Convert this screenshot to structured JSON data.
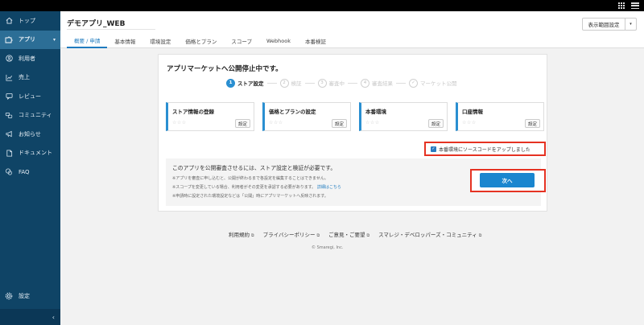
{
  "sidebar": {
    "items": [
      {
        "label": "トップ",
        "icon": "home-icon"
      },
      {
        "label": "アプリ",
        "icon": "puzzle-icon"
      },
      {
        "label": "利用者",
        "icon": "user-icon"
      },
      {
        "label": "売上",
        "icon": "trend-icon"
      },
      {
        "label": "レビュー",
        "icon": "review-icon"
      },
      {
        "label": "コミュニティ",
        "icon": "community-icon"
      },
      {
        "label": "お知らせ",
        "icon": "megaphone-icon"
      },
      {
        "label": "ドキュメント",
        "icon": "document-icon"
      },
      {
        "label": "FAQ",
        "icon": "faq-icon"
      }
    ],
    "active_caret": "▾",
    "settings_label": "設定",
    "collapse_glyph": "‹"
  },
  "header": {
    "app_title": "デモアプリ_WEB",
    "range_button": "表示範囲設定",
    "range_dropdown": "▾",
    "tabs": [
      "概要 / 申請",
      "基本情報",
      "環境設定",
      "価格とプラン",
      "スコープ",
      "Webhook",
      "本番検証"
    ]
  },
  "card": {
    "title": "アプリマーケットへ公開停止中です。",
    "steps": [
      {
        "num": "1",
        "label": "ストア設定"
      },
      {
        "num": "2",
        "label": "検証"
      },
      {
        "num": "3",
        "label": "審査中"
      },
      {
        "num": "4",
        "label": "審査結果"
      },
      {
        "num": "✓",
        "label": "マーケット公開"
      }
    ],
    "boxes": [
      {
        "title": "ストア情報の登録",
        "stars": "☆☆☆",
        "button": "設定"
      },
      {
        "title": "価格とプランの設定",
        "stars": "☆☆☆",
        "button": "設定"
      },
      {
        "title": "本番環境",
        "stars": "☆☆☆",
        "button": "設定"
      },
      {
        "title": "口座情報",
        "stars": "☆☆☆",
        "button": "設定"
      }
    ],
    "checkbox_label": "本番環境にソースコードをアップしました",
    "checkbox_mark": "✓",
    "info_main": "このアプリを公開審査させるには、ストア設定と検証が必要です。",
    "notes": [
      "※アプリを審査に申し込むと、公開が終わるまで各設定を編集することはできません。",
      "※スコープを変更している場合、利用者がその変更を承認する必要があります。",
      "※申請時に設定された環境設定などは「公開」時にアプリマーケットへ反映されます。"
    ],
    "note_link": "詳細はこちら",
    "next_button": "次へ"
  },
  "footer": {
    "links": [
      "利用規約",
      "プライバシーポリシー",
      "ご意見・ご要望",
      "スマレジ・デベロッパーズ・コミュニティ"
    ],
    "ext_glyph": "⧉",
    "copyright": "© Smaregi, Inc."
  },
  "colors": {
    "sidebar_bg": "#0f4466",
    "sidebar_active": "#2c6e96",
    "accent": "#1a86cf",
    "highlight": "#e53222"
  }
}
